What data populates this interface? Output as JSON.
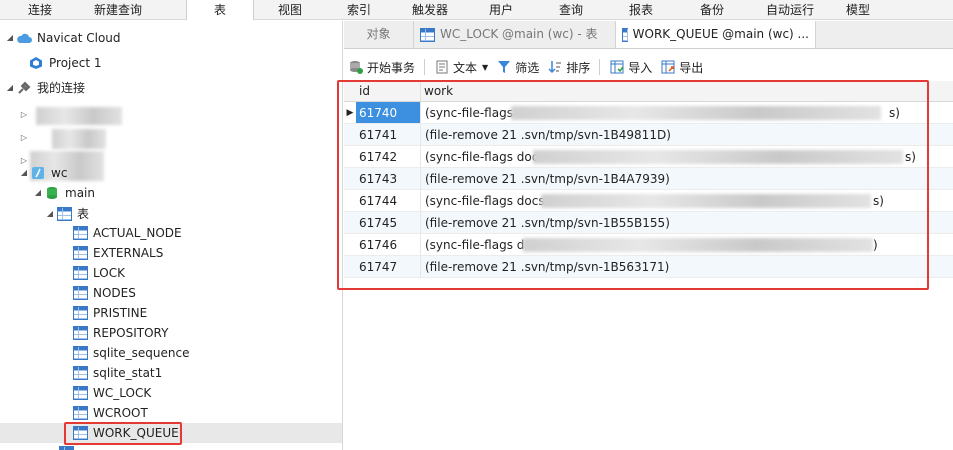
{
  "menu": {
    "items": [
      {
        "label": "连接"
      },
      {
        "label": "新建查询"
      },
      {
        "label": "表"
      },
      {
        "label": "视图"
      },
      {
        "label": "索引"
      },
      {
        "label": "触发器"
      },
      {
        "label": "用户"
      },
      {
        "label": "查询"
      },
      {
        "label": "报表"
      },
      {
        "label": "备份"
      },
      {
        "label": "自动运行"
      },
      {
        "label": "模型"
      }
    ],
    "active_index": 2
  },
  "tree": {
    "cloud": "Navicat Cloud",
    "project": "Project 1",
    "my_connections": "我的连接",
    "connection": "wc",
    "database": "main",
    "tables_group": "表",
    "tables": [
      "ACTUAL_NODE",
      "EXTERNALS",
      "LOCK",
      "NODES",
      "PRISTINE",
      "REPOSITORY",
      "sqlite_sequence",
      "sqlite_stat1",
      "WC_LOCK",
      "WCROOT",
      "WORK_QUEUE"
    ],
    "selected": "WORK_QUEUE"
  },
  "tabs": [
    {
      "label": "对象",
      "icon": "none"
    },
    {
      "label": "WC_LOCK @main (wc) - 表",
      "icon": "table-icon"
    },
    {
      "label": "WORK_QUEUE @main (wc) ...",
      "icon": "table-icon"
    }
  ],
  "toolbar": {
    "begin_transaction": "开始事务",
    "text": "文本",
    "filter": "筛选",
    "sort": "排序",
    "import": "导入",
    "export": "导出"
  },
  "grid": {
    "columns": [
      "id",
      "work"
    ],
    "rows": [
      {
        "id": "61740",
        "work": "(sync-file-flags",
        "tail": "s)"
      },
      {
        "id": "61741",
        "work": "(file-remove 21 .svn/tmp/svn-1B49811D)",
        "tail": ""
      },
      {
        "id": "61742",
        "work": "(sync-file-flags doc",
        "tail": "s)"
      },
      {
        "id": "61743",
        "work": "(file-remove 21 .svn/tmp/svn-1B4A7939)",
        "tail": ""
      },
      {
        "id": "61744",
        "work": "(sync-file-flags docs",
        "tail": "s)"
      },
      {
        "id": "61745",
        "work": "(file-remove 21 .svn/tmp/svn-1B55B155)",
        "tail": ""
      },
      {
        "id": "61746",
        "work": "(sync-file-flags d",
        "tail": ")"
      },
      {
        "id": "61747",
        "work": "(file-remove 21 .svn/tmp/svn-1B563171)",
        "tail": ""
      }
    ],
    "selected_row": 0
  },
  "colors": {
    "highlight": "#e53935",
    "selection": "#3d8fe0"
  }
}
